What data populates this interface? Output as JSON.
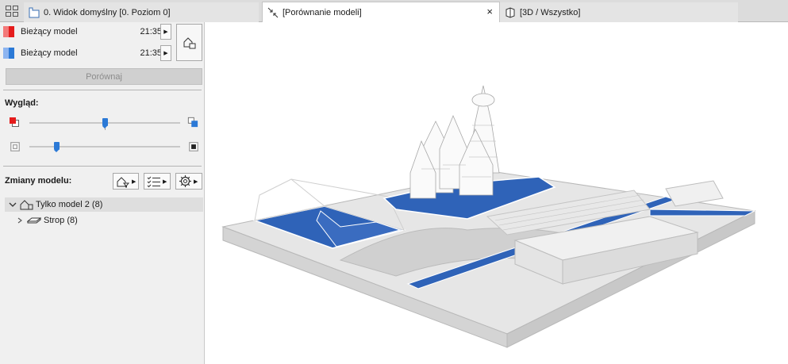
{
  "tabs": [
    {
      "label": "0. Widok domyślny [0. Poziom 0]",
      "icon": "floorplan-icon"
    },
    {
      "label": "[Porównanie modeli]",
      "icon": "compare-arrows-icon"
    },
    {
      "label": "[3D / Wszystko]",
      "icon": "3d-box-icon"
    }
  ],
  "tab_close_glyph": "×",
  "models": [
    {
      "label": "Bieżący model",
      "time": "21:35",
      "swatch": [
        "#f37a7a",
        "#e51c1c"
      ],
      "arrow": "▶"
    },
    {
      "label": "Bieżący model",
      "time": "21:35",
      "swatch": [
        "#8cb4f0",
        "#2b79d6"
      ],
      "arrow": "▶"
    }
  ],
  "compare_button": "Porównaj",
  "appearance_heading": "Wygląd:",
  "changes_heading": "Zmiany modelu:",
  "tool_arrow": "▶",
  "tree": {
    "root_label": "Tylko model 2 (8)",
    "child_label": "Strop (8)"
  },
  "colors": {
    "accent_blue": "#2b79d6",
    "model1_red": "#e51c1c",
    "model2_blue": "#2b79d6",
    "slab_blue": "#2f63b8"
  }
}
